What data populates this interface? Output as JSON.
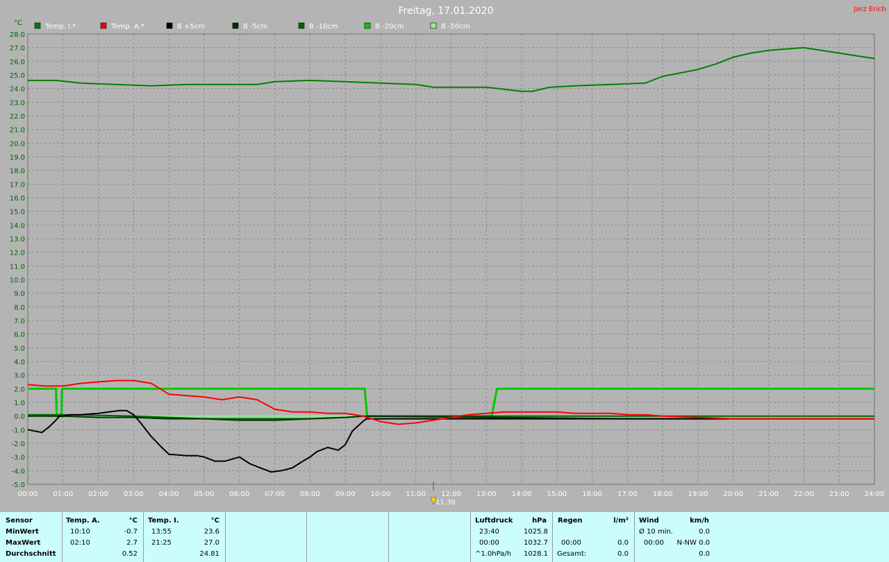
{
  "title": "Freitag, 17.01.2020",
  "author": "Jarz Erich",
  "chart_data": {
    "type": "line",
    "ylabel": "°C",
    "ylim": [
      -5.0,
      28.0
    ],
    "xlim": [
      0,
      24
    ],
    "y_ticks": [
      "28.0",
      "27.0",
      "26.0",
      "25.0",
      "24.0",
      "23.0",
      "22.0",
      "21.0",
      "20.0",
      "19.0",
      "18.0",
      "17.0",
      "16.0",
      "15.0",
      "14.0",
      "13.0",
      "12.0",
      "11.0",
      "10.0",
      "9.0",
      "8.0",
      "7.0",
      "6.0",
      "5.0",
      "4.0",
      "3.0",
      "2.0",
      "1.0",
      "0.0",
      "-1.0",
      "-2.0",
      "-3.0",
      "-4.0",
      "-5.0"
    ],
    "x_ticks": [
      "00:00",
      "01:00",
      "02:00",
      "03:00",
      "04:00",
      "05:00",
      "06:00",
      "07:00",
      "08:00",
      "09:00",
      "10:00",
      "11:00",
      "12:00",
      "13:00",
      "14:00",
      "15:00",
      "16:00",
      "17:00",
      "18:00",
      "19:00",
      "20:00",
      "21:00",
      "22:00",
      "23:00",
      "24:00"
    ],
    "grid": true,
    "marker": {
      "label": "11:30",
      "x": 11.5
    },
    "series": [
      {
        "name": "Temp. I.*",
        "color": "#008000",
        "width": 2,
        "x": [
          0,
          0.8,
          1.5,
          2.5,
          3.5,
          4.5,
          5.5,
          6.5,
          7,
          8,
          9,
          10,
          11,
          11.5,
          12,
          13,
          14,
          14.3,
          14.8,
          15.5,
          16.5,
          17.5,
          18,
          19,
          19.5,
          20,
          20.5,
          21,
          21.5,
          22,
          22.5,
          23,
          23.5,
          24
        ],
        "y": [
          24.6,
          24.6,
          24.4,
          24.3,
          24.2,
          24.3,
          24.3,
          24.3,
          24.5,
          24.6,
          24.5,
          24.4,
          24.3,
          24.1,
          24.1,
          24.1,
          23.8,
          23.8,
          24.1,
          24.2,
          24.3,
          24.4,
          24.9,
          25.4,
          25.8,
          26.3,
          26.6,
          26.8,
          26.9,
          27.0,
          26.8,
          26.6,
          26.4,
          26.2
        ]
      },
      {
        "name": "Temp. A.*",
        "color": "#ff0000",
        "width": 2,
        "x": [
          0,
          0.5,
          1,
          1.5,
          2,
          2.5,
          3,
          3.5,
          4,
          4.5,
          5,
          5.5,
          6,
          6.5,
          7,
          7.5,
          8,
          8.5,
          9,
          9.5,
          10,
          10.5,
          11,
          11.5,
          12,
          12.5,
          13,
          13.5,
          14,
          14.5,
          15,
          15.5,
          16,
          16.5,
          17,
          17.5,
          18,
          19,
          20,
          21,
          22,
          23,
          24
        ],
        "y": [
          2.3,
          2.2,
          2.2,
          2.4,
          2.5,
          2.6,
          2.6,
          2.4,
          1.6,
          1.5,
          1.4,
          1.2,
          1.4,
          1.2,
          0.5,
          0.3,
          0.3,
          0.2,
          0.2,
          0.0,
          -0.4,
          -0.6,
          -0.5,
          -0.3,
          -0.1,
          0.1,
          0.2,
          0.3,
          0.3,
          0.3,
          0.3,
          0.2,
          0.2,
          0.2,
          0.1,
          0.1,
          0.0,
          -0.1,
          -0.2,
          -0.2,
          -0.2,
          -0.2,
          -0.2
        ]
      },
      {
        "name": "B +5cm",
        "color": "#000000",
        "width": 2,
        "x": [
          0,
          0.2,
          0.4,
          0.6,
          0.8,
          0.9,
          1,
          1.2,
          1.5,
          2,
          2.3,
          2.6,
          2.8,
          3,
          3.2,
          3.5,
          3.8,
          4,
          4.5,
          4.8,
          5,
          5.3,
          5.6,
          6,
          6.3,
          6.6,
          6.9,
          7.2,
          7.5,
          7.8,
          8,
          8.2,
          8.5,
          8.8,
          9,
          9.2,
          9.5,
          9.6,
          13.2,
          24
        ],
        "y": [
          -1.0,
          -1.1,
          -1.2,
          -0.8,
          -0.3,
          0.0,
          0.0,
          0.1,
          0.1,
          0.2,
          0.3,
          0.4,
          0.4,
          0.1,
          -0.5,
          -1.5,
          -2.3,
          -2.8,
          -2.9,
          -2.9,
          -3.0,
          -3.3,
          -3.3,
          -3.0,
          -3.5,
          -3.8,
          -4.1,
          -4.0,
          -3.8,
          -3.3,
          -3.0,
          -2.6,
          -2.3,
          -2.5,
          -2.1,
          -1.1,
          -0.4,
          -0.2,
          -0.2,
          -0.2
        ]
      },
      {
        "name": "B -5cm",
        "color": "#003000",
        "width": 2,
        "x": [
          0,
          1,
          2,
          3,
          4,
          5,
          6,
          7,
          8,
          9,
          9.5,
          13.2,
          17,
          24
        ],
        "y": [
          0.0,
          0.0,
          -0.1,
          -0.1,
          -0.2,
          -0.2,
          -0.3,
          -0.3,
          -0.2,
          -0.1,
          0.0,
          -0.1,
          -0.2,
          -0.2
        ]
      },
      {
        "name": "B -10cm",
        "color": "#006400",
        "width": 2,
        "x": [
          0,
          1,
          3,
          4,
          5,
          6,
          7,
          8,
          9,
          9.6,
          13.2,
          24
        ],
        "y": [
          0.1,
          0.1,
          0.0,
          -0.1,
          -0.2,
          -0.2,
          -0.2,
          -0.2,
          -0.1,
          0.0,
          0.0,
          0.0
        ]
      },
      {
        "name": "B -20cm",
        "color": "#00c800",
        "width": 3,
        "x": [
          0,
          0.8,
          0.82,
          0.95,
          0.97,
          9.55,
          9.62,
          13.15,
          13.3,
          24
        ],
        "y": [
          2.0,
          2.0,
          0.0,
          0.0,
          2.0,
          2.0,
          0.0,
          0.0,
          2.0,
          2.0
        ]
      },
      {
        "name": "B -50cm",
        "color": "#90ee90",
        "width": 2,
        "x": [
          0,
          24
        ],
        "y": [
          0.0,
          0.0
        ]
      }
    ]
  },
  "stats": {
    "sensor_header": "Sensor",
    "row_labels": [
      "MinWert",
      "MaxWert",
      "Durchschnitt"
    ],
    "temp_a": {
      "header": "Temp. A.",
      "unit": "°C",
      "rows": [
        [
          "10:10",
          "-0.7"
        ],
        [
          "02:10",
          "2.7"
        ],
        [
          "",
          "0.52"
        ]
      ]
    },
    "temp_i": {
      "header": "Temp. I.",
      "unit": "°C",
      "rows": [
        [
          "13:55",
          "23.6"
        ],
        [
          "21:25",
          "27.0"
        ],
        [
          "",
          "24.81"
        ]
      ]
    },
    "pressure": {
      "header": "Luftdruck",
      "unit": "hPa",
      "rows": [
        [
          "23:40",
          "1025.8"
        ],
        [
          "00:00",
          "1032.7"
        ],
        [
          "^1.0hPa/h",
          "1028.1"
        ]
      ]
    },
    "rain": {
      "header": "Regen",
      "unit": "l/m²",
      "rows": [
        [
          "",
          ""
        ],
        [
          "00:00",
          "0.0"
        ],
        [
          "Gesamt:",
          "0.0"
        ]
      ]
    },
    "wind": {
      "header": "Wind",
      "unit": "km/h",
      "rows": [
        [
          "Ø 10 min.",
          "0.0"
        ],
        [
          "00:00",
          "N-NW 0.0"
        ],
        [
          "",
          "0.0"
        ]
      ]
    }
  }
}
